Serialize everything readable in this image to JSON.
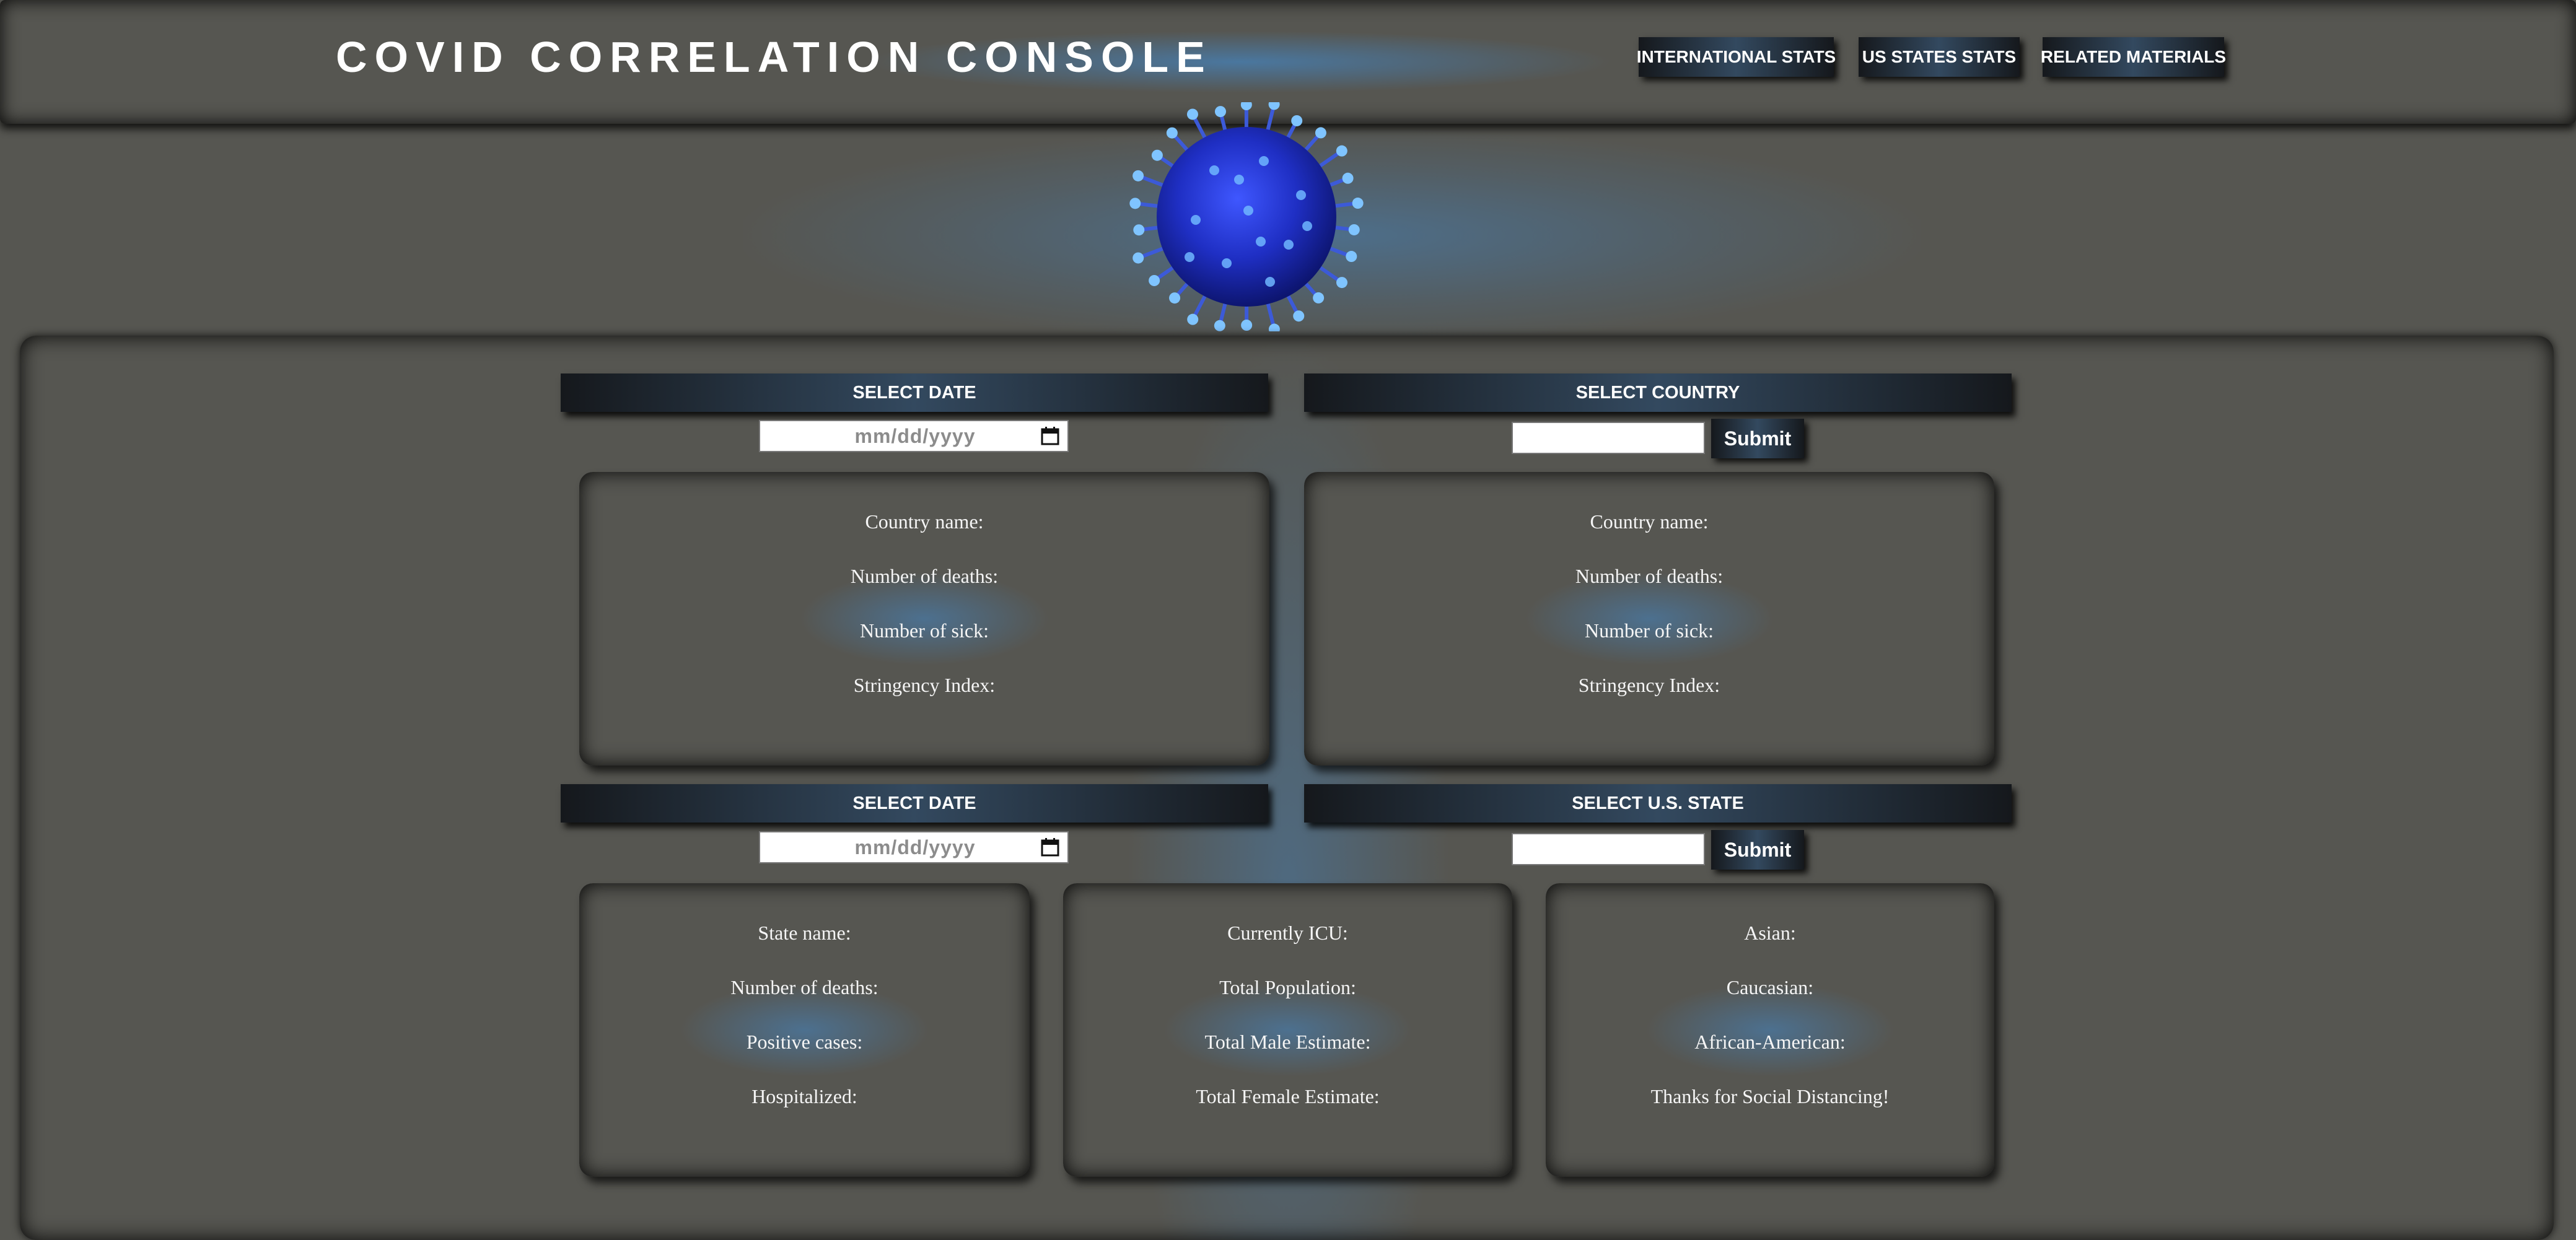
{
  "header": {
    "title": "COVID CORRELATION CONSOLE",
    "nav": [
      "INTERNATIONAL STATS",
      "US STATES STATS",
      "RELATED MATERIALS"
    ]
  },
  "international": {
    "date_label": "SELECT DATE",
    "date_placeholder": "mm/dd/yyyy",
    "country_label": "SELECT COUNTRY",
    "country_value": "",
    "submit_label": "Submit",
    "card_left": [
      "Country name:",
      "Number of deaths:",
      "Number of sick:",
      "Stringency Index:"
    ],
    "card_right": [
      "Country name:",
      "Number of deaths:",
      "Number of sick:",
      "Stringency Index:"
    ]
  },
  "us": {
    "date_label": "SELECT DATE",
    "date_placeholder": "mm/dd/yyyy",
    "state_label": "SELECT U.S. STATE",
    "state_value": "",
    "submit_label": "Submit",
    "card_state": [
      "State name:",
      "Number of deaths:",
      "Positive cases:",
      "Hospitalized:"
    ],
    "card_population": [
      "Currently ICU:",
      "Total Population:",
      "Total Male Estimate:",
      "Total Female Estimate:"
    ],
    "card_demographics": [
      "Asian:",
      "Caucasian:",
      "African-American:",
      "Thanks for Social Distancing!"
    ]
  },
  "icons": {
    "virus": "virus-icon",
    "calendar": "calendar-icon"
  },
  "colors": {
    "background": "#565651",
    "accent": "#4682b9",
    "button_dark": "#15181c",
    "button_mid": "#33495f"
  }
}
